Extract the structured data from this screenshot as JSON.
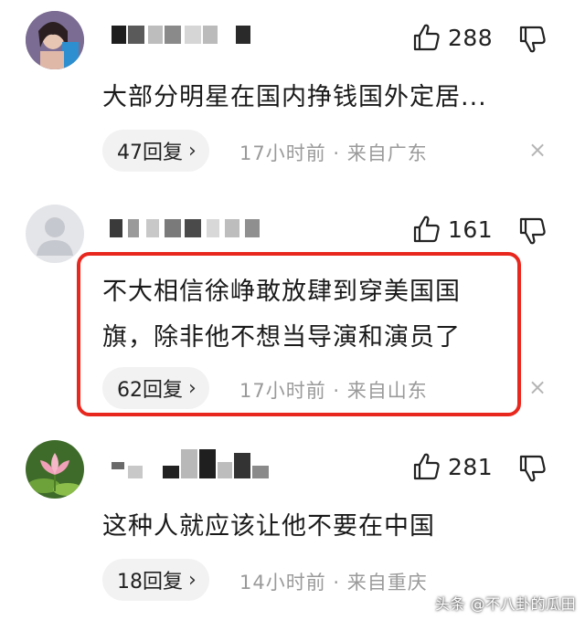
{
  "comments": [
    {
      "likes": "288",
      "text": "大部分明星在国内挣钱国外定居...",
      "reply_count": "47回复",
      "time": "17小时前",
      "location": "来自广东"
    },
    {
      "likes": "161",
      "text_line1": "不大相信徐峥敢放肆到穿美国国",
      "text_line2": "旗，除非他不想当导演和演员了",
      "reply_count": "62回复",
      "time": "17小时前",
      "location": "来自山东"
    },
    {
      "likes": "281",
      "text": "这种人就应该让他不要在中国",
      "reply_count": "18回复",
      "time": "14小时前",
      "location": "来自重庆"
    }
  ],
  "labels": {
    "reply_chevron": "›",
    "meta_separator": " · ",
    "close": "×"
  },
  "watermark": "头条 @不八卦的瓜田",
  "colors": {
    "highlight_border": "#e8281e",
    "reply_bg": "#f2f2f3",
    "meta_text": "#9a9a9a"
  },
  "icons": [
    "thumbs-up-icon",
    "thumbs-down-icon",
    "close-icon",
    "chevron-right-icon",
    "avatar-default-icon"
  ]
}
